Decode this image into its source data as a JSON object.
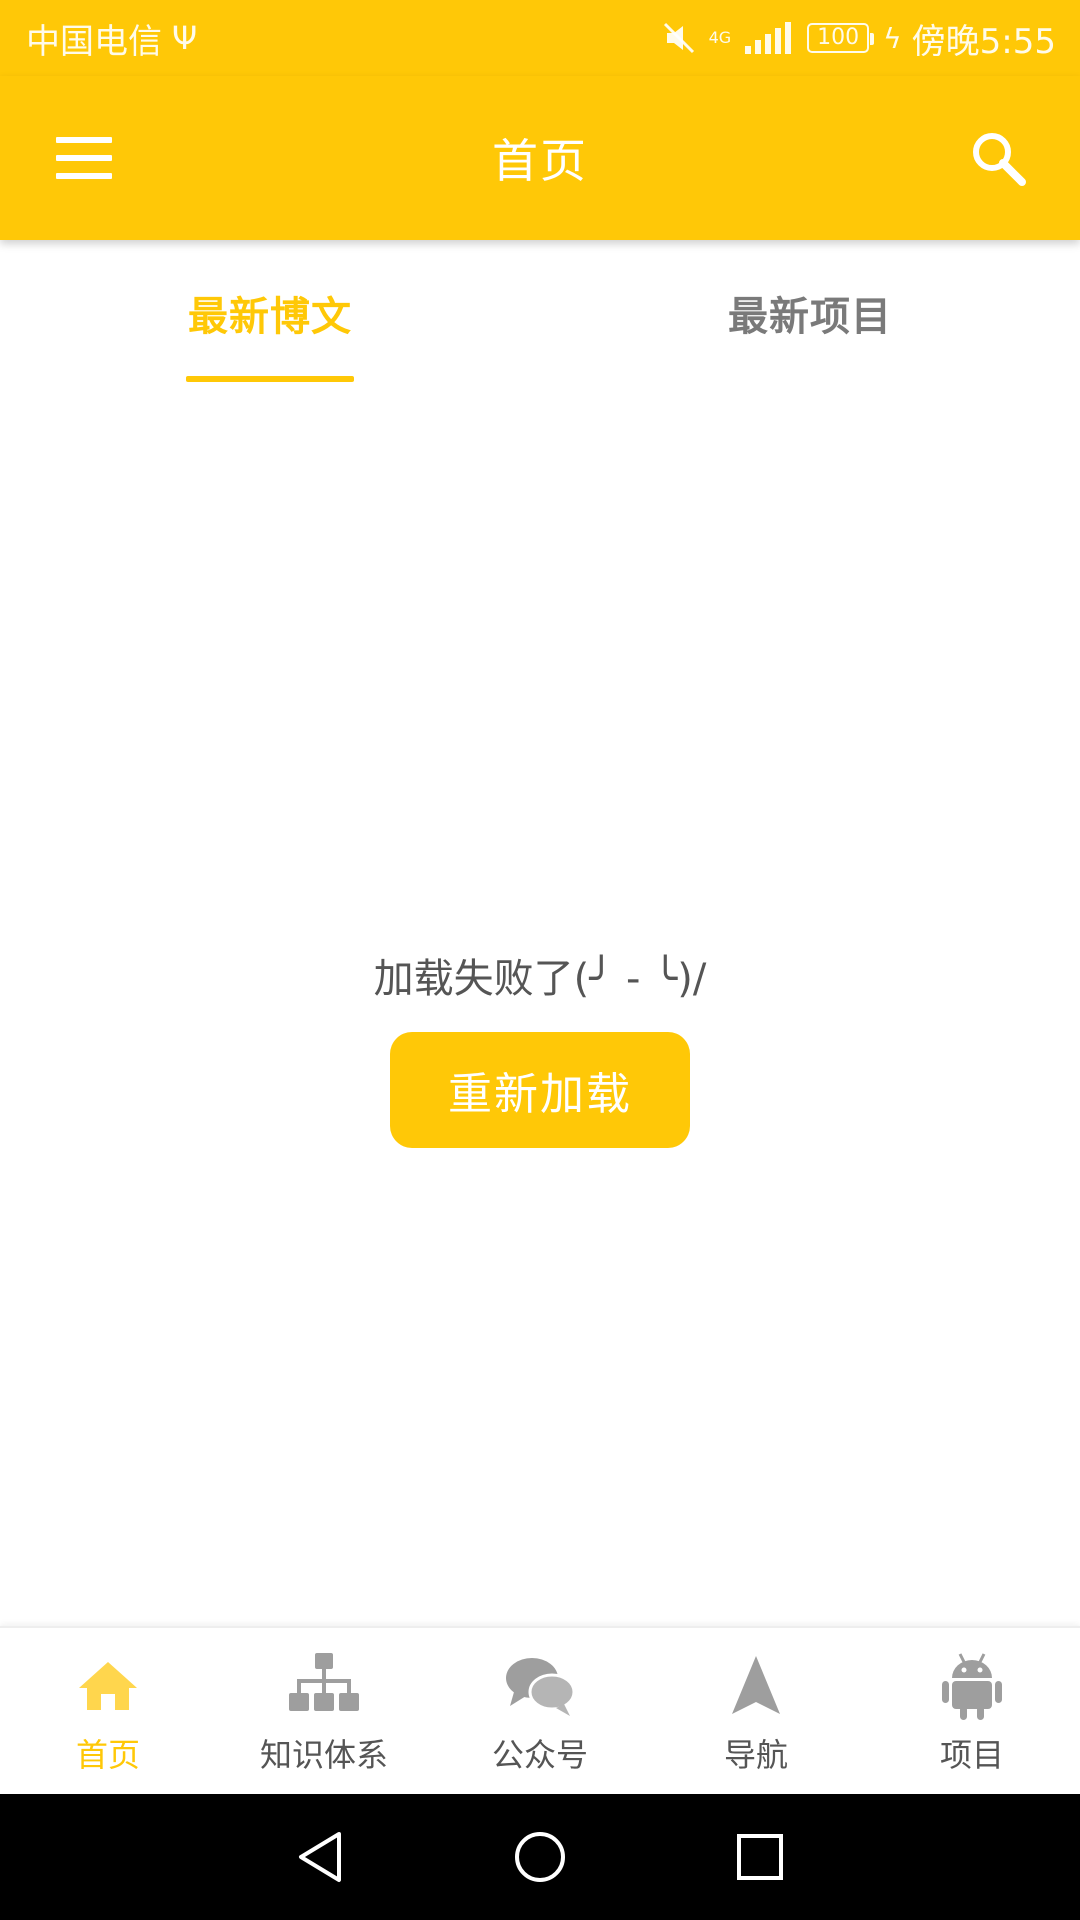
{
  "status_bar": {
    "carrier": "中国电信",
    "network": "4G",
    "battery": "100",
    "time": "傍晚5:55"
  },
  "toolbar": {
    "title": "首页",
    "menu_icon": "hamburger-menu-icon",
    "search_icon": "search-icon"
  },
  "tabs": [
    {
      "label": "最新博文",
      "active": true
    },
    {
      "label": "最新项目",
      "active": false
    }
  ],
  "content": {
    "error_text": "加载失败了(╯ - ╰)/",
    "reload_label": "重新加载"
  },
  "bottom_nav": [
    {
      "label": "首页",
      "icon": "home-icon",
      "active": true
    },
    {
      "label": "知识体系",
      "icon": "hierarchy-icon",
      "active": false
    },
    {
      "label": "公众号",
      "icon": "chat-bubbles-icon",
      "active": false
    },
    {
      "label": "导航",
      "icon": "navigation-arrow-icon",
      "active": false
    },
    {
      "label": "项目",
      "icon": "android-icon",
      "active": false
    }
  ],
  "colors": {
    "accent": "#FFC807",
    "inactive_tab": "#7a7a7a",
    "inactive_icon": "#9e9e9e",
    "active_icon": "#FFD64D"
  }
}
